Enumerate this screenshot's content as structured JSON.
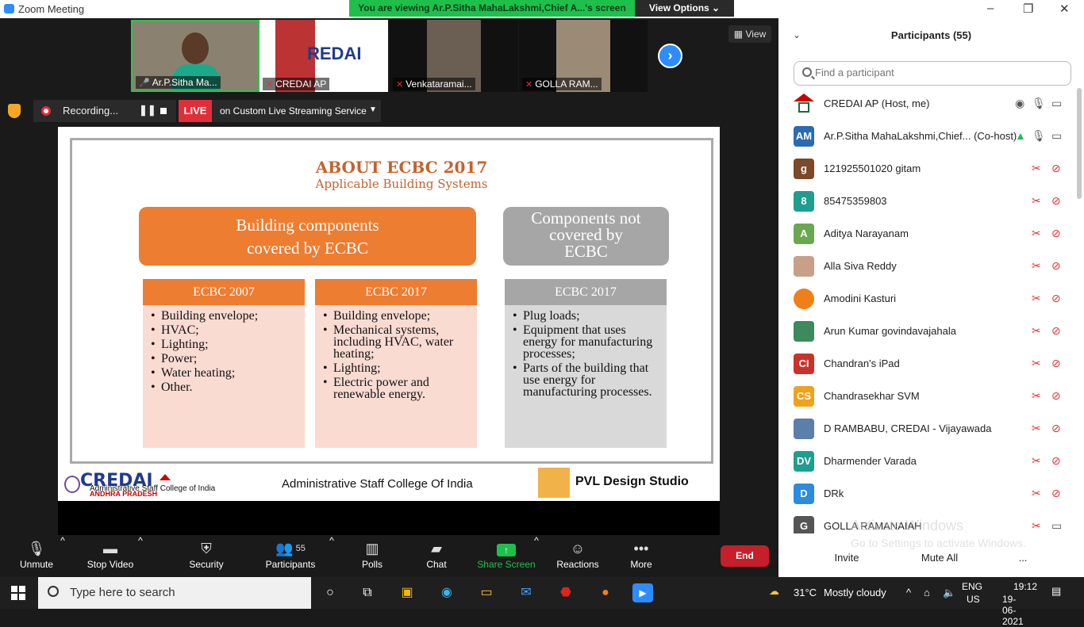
{
  "window": {
    "app_title": "Zoom Meeting",
    "viewing_banner": "You are viewing Ar.P.Sitha MahaLakshmi,Chief A...'s screen",
    "view_options": "View Options ⌄",
    "view_button": "View"
  },
  "thumbnails": [
    {
      "name": "Ar.P.Sitha Ma..."
    },
    {
      "name": "CREDAI AP"
    },
    {
      "name": "Venkataramai..."
    },
    {
      "name": "GOLLA RAM..."
    }
  ],
  "recording": {
    "label": "Recording...",
    "live": "LIVE",
    "service": "on Custom Live Streaming Service"
  },
  "slide": {
    "title": "ABOUT ECBC 2017",
    "subtitle": "Applicable Building Systems",
    "covered_title_1": "Building components",
    "covered_title_2": "covered by ECBC",
    "not_covered_title_1": "Components not",
    "not_covered_title_2": "covered by",
    "not_covered_title_3": "ECBC",
    "col1": {
      "header": "ECBC 2007",
      "items": [
        "Building envelope;",
        "HVAC;",
        "Lighting;",
        "Power;",
        "Water heating;",
        "Other."
      ]
    },
    "col2": {
      "header": "ECBC 2017",
      "items": [
        "Building envelope;",
        "Mechanical systems, including HVAC, water heating;",
        "Lighting;",
        "Electric power and renewable energy."
      ]
    },
    "col3": {
      "header": "ECBC 2017",
      "items": [
        "Plug loads;",
        "Equipment that uses energy for manufacturing processes;",
        "Parts of the building that use energy for manufacturing processes."
      ]
    },
    "footer_logo": "CREDAI",
    "footer_logo_sub": "ANDHRA PRADESH",
    "footer_small": "Administrative Staff College of India",
    "footer_center": "Administrative Staff College Of India",
    "footer_right": "PVL Design Studio"
  },
  "participants": {
    "title": "Participants (55)",
    "search_placeholder": "Find a participant",
    "list": [
      {
        "initials": "",
        "name": "CREDAI AP (Host, me)",
        "color": "#ffffff"
      },
      {
        "initials": "AM",
        "name": "Ar.P.Sitha MahaLakshmi,Chief... (Co-host)",
        "color": "#2b6cb0"
      },
      {
        "initials": "g",
        "name": "121925501020 gitam",
        "color": "#7a4a2a"
      },
      {
        "initials": "8",
        "name": "85475359803",
        "color": "#1e9e8e"
      },
      {
        "initials": "A",
        "name": "Aditya Narayanam",
        "color": "#6aa84f"
      },
      {
        "initials": "",
        "name": "Alla Siva Reddy",
        "color": "#c8a088"
      },
      {
        "initials": "",
        "name": "Amodini Kasturi",
        "color": "#f07f1a"
      },
      {
        "initials": "",
        "name": "Arun Kumar govindavajahala",
        "color": "#3d8a5c"
      },
      {
        "initials": "CI",
        "name": "Chandran's iPad",
        "color": "#c9322a"
      },
      {
        "initials": "CS",
        "name": "Chandrasekhar SVM",
        "color": "#f0a21a"
      },
      {
        "initials": "",
        "name": "D RAMBABU, CREDAI - Vijayawada",
        "color": "#5a7fa8"
      },
      {
        "initials": "DV",
        "name": "Dharmender Varada",
        "color": "#1e9e8e"
      },
      {
        "initials": "D",
        "name": "DRk",
        "color": "#2b8be0"
      },
      {
        "initials": "G",
        "name": "GOLLA RAMANAIAH",
        "color": "#555555"
      }
    ],
    "invite": "Invite",
    "mute_all": "Mute All",
    "more": "..."
  },
  "activate": {
    "line1": "Activate Windows",
    "line2": "Go to Settings to activate Windows."
  },
  "toolbar": {
    "unmute": "Unmute",
    "stop_video": "Stop Video",
    "security": "Security",
    "participants": "Participants",
    "participants_count": "55",
    "polls": "Polls",
    "chat": "Chat",
    "share_screen": "Share Screen",
    "reactions": "Reactions",
    "more": "More",
    "end": "End"
  },
  "taskbar": {
    "search": "Type here to search",
    "weather_temp": "31°C",
    "weather_text": "Mostly cloudy",
    "lang": "ENG",
    "region": "US",
    "time": "19:12",
    "date": "19-06-2021"
  },
  "colors": {
    "zoom_blue": "#2d8cff",
    "banner_green": "#1ec04b",
    "slide_orange": "#ed7d31",
    "end_red": "#c51f2a"
  }
}
